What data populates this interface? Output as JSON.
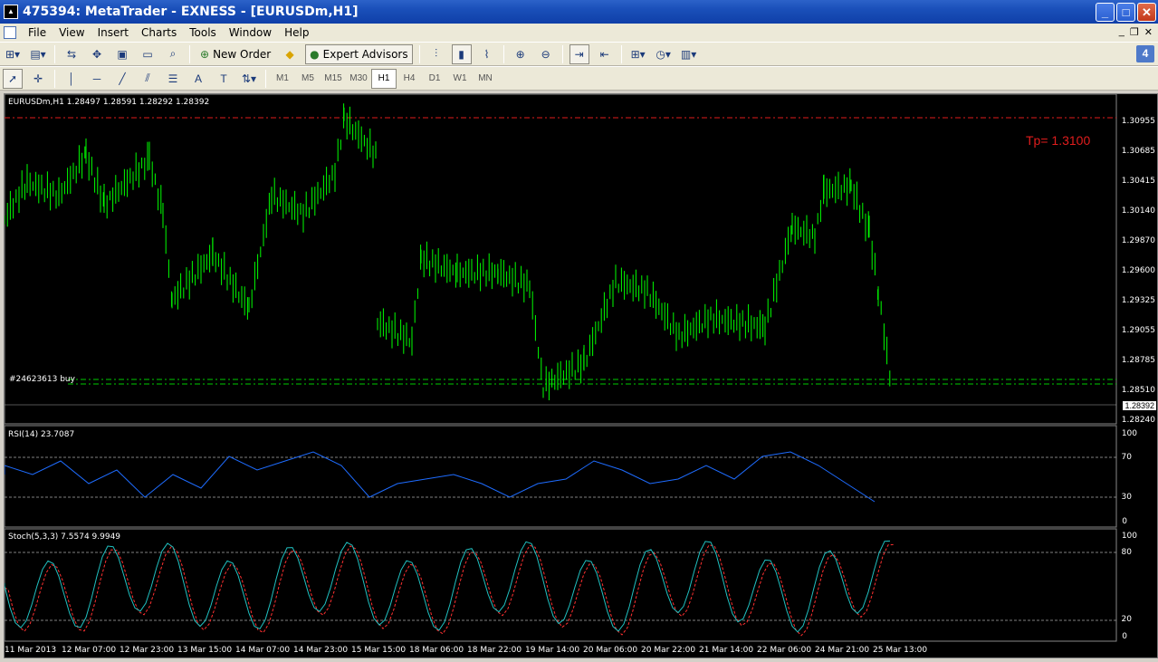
{
  "window": {
    "title": "475394: MetaTrader - EXNESS - [EURUSDm,H1]",
    "app_icon": "mt-logo-icon"
  },
  "menu": [
    "File",
    "View",
    "Insert",
    "Charts",
    "Tools",
    "Window",
    "Help"
  ],
  "toolbar": {
    "new_order": "New Order",
    "expert_advisors": "Expert Advisors",
    "badge": "4"
  },
  "timeframes": [
    "M1",
    "M5",
    "M15",
    "M30",
    "H1",
    "H4",
    "D1",
    "W1",
    "MN"
  ],
  "active_timeframe": "H1",
  "chart": {
    "header": "EURUSDm,H1  1.28497 1.28591 1.28292 1.28392",
    "tp_label": "Tp= 1.3100",
    "order_label": "#24623613 buy",
    "current_price": "1.28392",
    "price_axis": [
      "1.30955",
      "1.30685",
      "1.30415",
      "1.30140",
      "1.29870",
      "1.29600",
      "1.29325",
      "1.29055",
      "1.28785",
      "1.28510",
      "1.28240"
    ],
    "colors": {
      "candle": "#00ff00",
      "tp_line": "#e01d1d",
      "order_line": "#00cc00",
      "rsi": "#1e6cff",
      "stoch_main": "#20c0c0",
      "stoch_signal": "#ff3030"
    }
  },
  "rsi": {
    "header": "RSI(14) 23.7087",
    "levels": [
      "100",
      "70",
      "30",
      "0"
    ]
  },
  "stoch": {
    "header": "Stoch(5,3,3) 7.5574 9.9949",
    "levels": [
      "100",
      "80",
      "20",
      "0"
    ]
  },
  "time_axis": [
    "11 Mar 2013",
    "12 Mar 07:00",
    "12 Mar 23:00",
    "13 Mar 15:00",
    "14 Mar 07:00",
    "14 Mar 23:00",
    "15 Mar 15:00",
    "18 Mar 06:00",
    "18 Mar 22:00",
    "19 Mar 14:00",
    "20 Mar 06:00",
    "20 Mar 22:00",
    "21 Mar 14:00",
    "22 Mar 06:00",
    "24 Mar 21:00",
    "25 Mar 13:00"
  ]
}
